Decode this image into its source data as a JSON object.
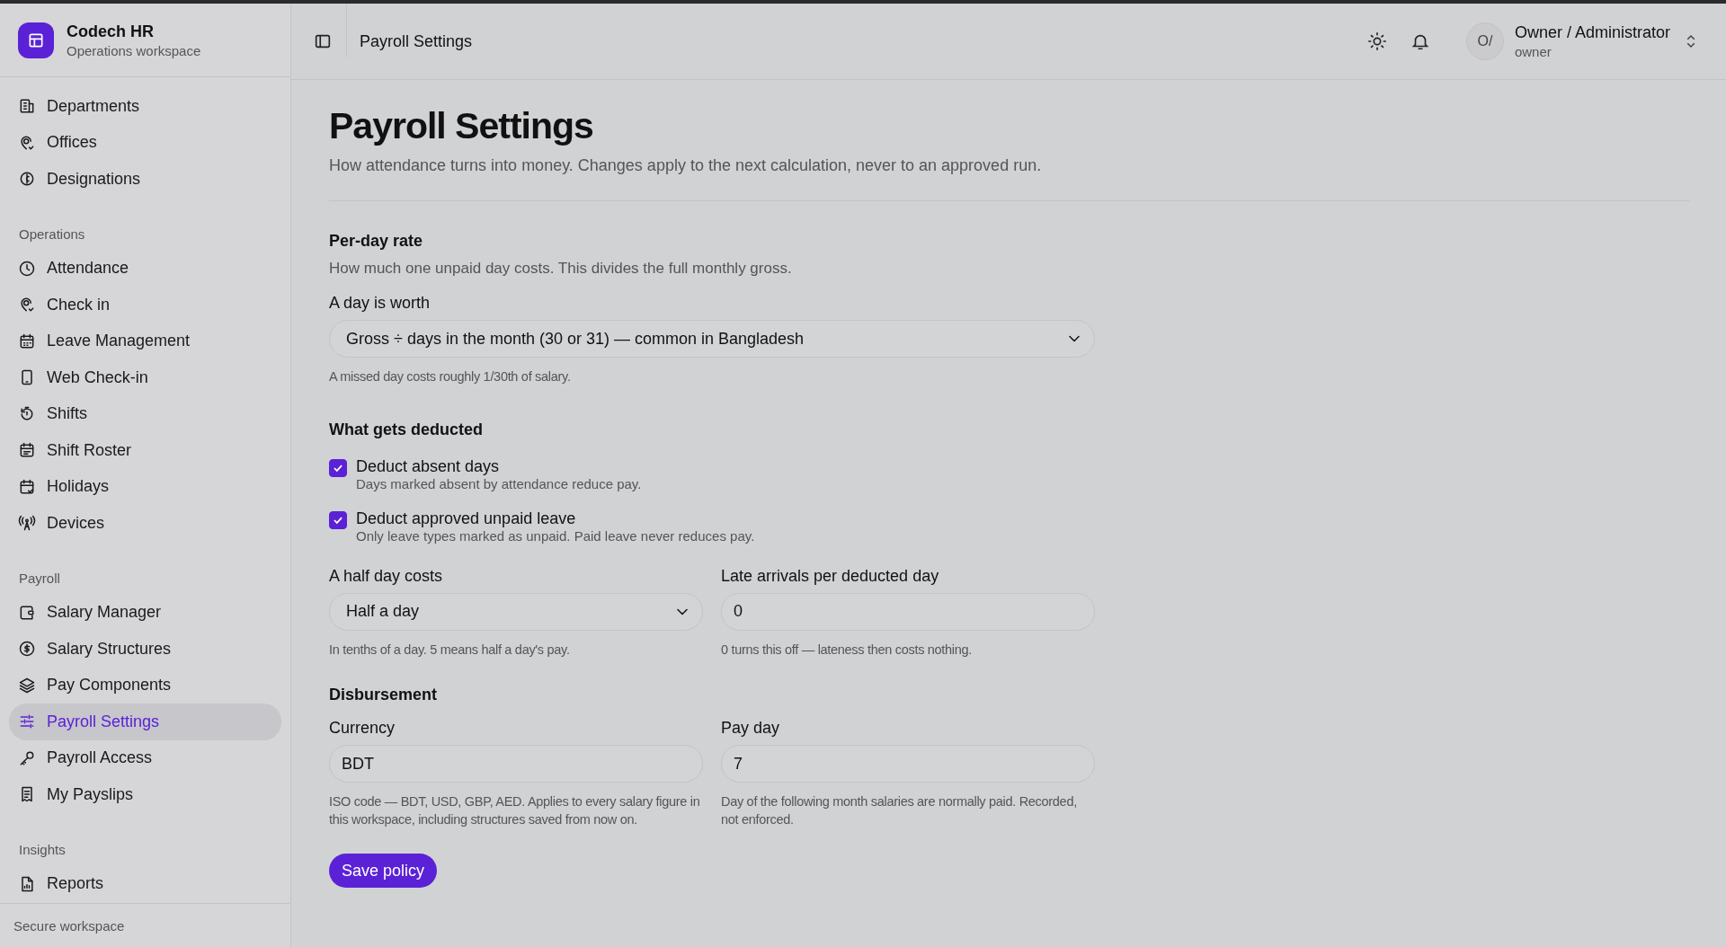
{
  "brand": {
    "name": "Codech HR",
    "subtitle": "Operations workspace"
  },
  "sidebar": {
    "sections": [
      {
        "items": [
          {
            "label": "Departments",
            "selected": false
          },
          {
            "label": "Offices",
            "selected": false
          },
          {
            "label": "Designations",
            "selected": false
          }
        ]
      },
      {
        "title": "Operations",
        "items": [
          {
            "label": "Attendance",
            "selected": false
          },
          {
            "label": "Check in",
            "selected": false
          },
          {
            "label": "Leave Management",
            "selected": false
          },
          {
            "label": "Web Check-in",
            "selected": false
          },
          {
            "label": "Shifts",
            "selected": false
          },
          {
            "label": "Shift Roster",
            "selected": false
          },
          {
            "label": "Holidays",
            "selected": false
          },
          {
            "label": "Devices",
            "selected": false
          }
        ]
      },
      {
        "title": "Payroll",
        "items": [
          {
            "label": "Salary Manager",
            "selected": false
          },
          {
            "label": "Salary Structures",
            "selected": false
          },
          {
            "label": "Pay Components",
            "selected": false
          },
          {
            "label": "Payroll Settings",
            "selected": true
          },
          {
            "label": "Payroll Access",
            "selected": false
          },
          {
            "label": "My Payslips",
            "selected": false
          }
        ]
      },
      {
        "title": "Insights",
        "items": [
          {
            "label": "Reports",
            "selected": false
          }
        ]
      }
    ],
    "footer": "Secure workspace"
  },
  "header": {
    "title": "Payroll Settings",
    "user": {
      "initials": "O/",
      "name": "Owner / Administrator",
      "role": "owner"
    }
  },
  "page": {
    "title": "Payroll Settings",
    "subtitle": "How attendance turns into money. Changes apply to the next calculation, never to an approved run.",
    "per_day": {
      "heading": "Per-day rate",
      "description": "How much one unpaid day costs. This divides the full monthly gross.",
      "label": "A day is worth",
      "value": "Gross ÷ days in the month (30 or 31) — common in Bangladesh",
      "hint": "A missed day costs roughly 1/30th of salary."
    },
    "deductions": {
      "heading": "What gets deducted",
      "options": [
        {
          "label": "Deduct absent days",
          "description": "Days marked absent by attendance reduce pay.",
          "checked": true
        },
        {
          "label": "Deduct approved unpaid leave",
          "description": "Only leave types marked as unpaid. Paid leave never reduces pay.",
          "checked": true
        }
      ],
      "fields": [
        {
          "kind": "select",
          "label": "A half day costs",
          "value": "Half a day",
          "hint": "In tenths of a day. 5 means half a day's pay."
        },
        {
          "kind": "input",
          "label": "Late arrivals per deducted day",
          "value": "0",
          "hint": "0 turns this off — lateness then costs nothing."
        }
      ]
    },
    "disbursement": {
      "heading": "Disbursement",
      "fields": [
        {
          "kind": "input",
          "label": "Currency",
          "value": "BDT",
          "hint": "ISO code — BDT, USD, GBP, AED. Applies to every salary figure in this workspace, including structures saved from now on."
        },
        {
          "kind": "input",
          "label": "Pay day",
          "value": "7",
          "hint": "Day of the following month salaries are normally paid. Recorded, not enforced."
        }
      ]
    },
    "save": "Save policy"
  }
}
